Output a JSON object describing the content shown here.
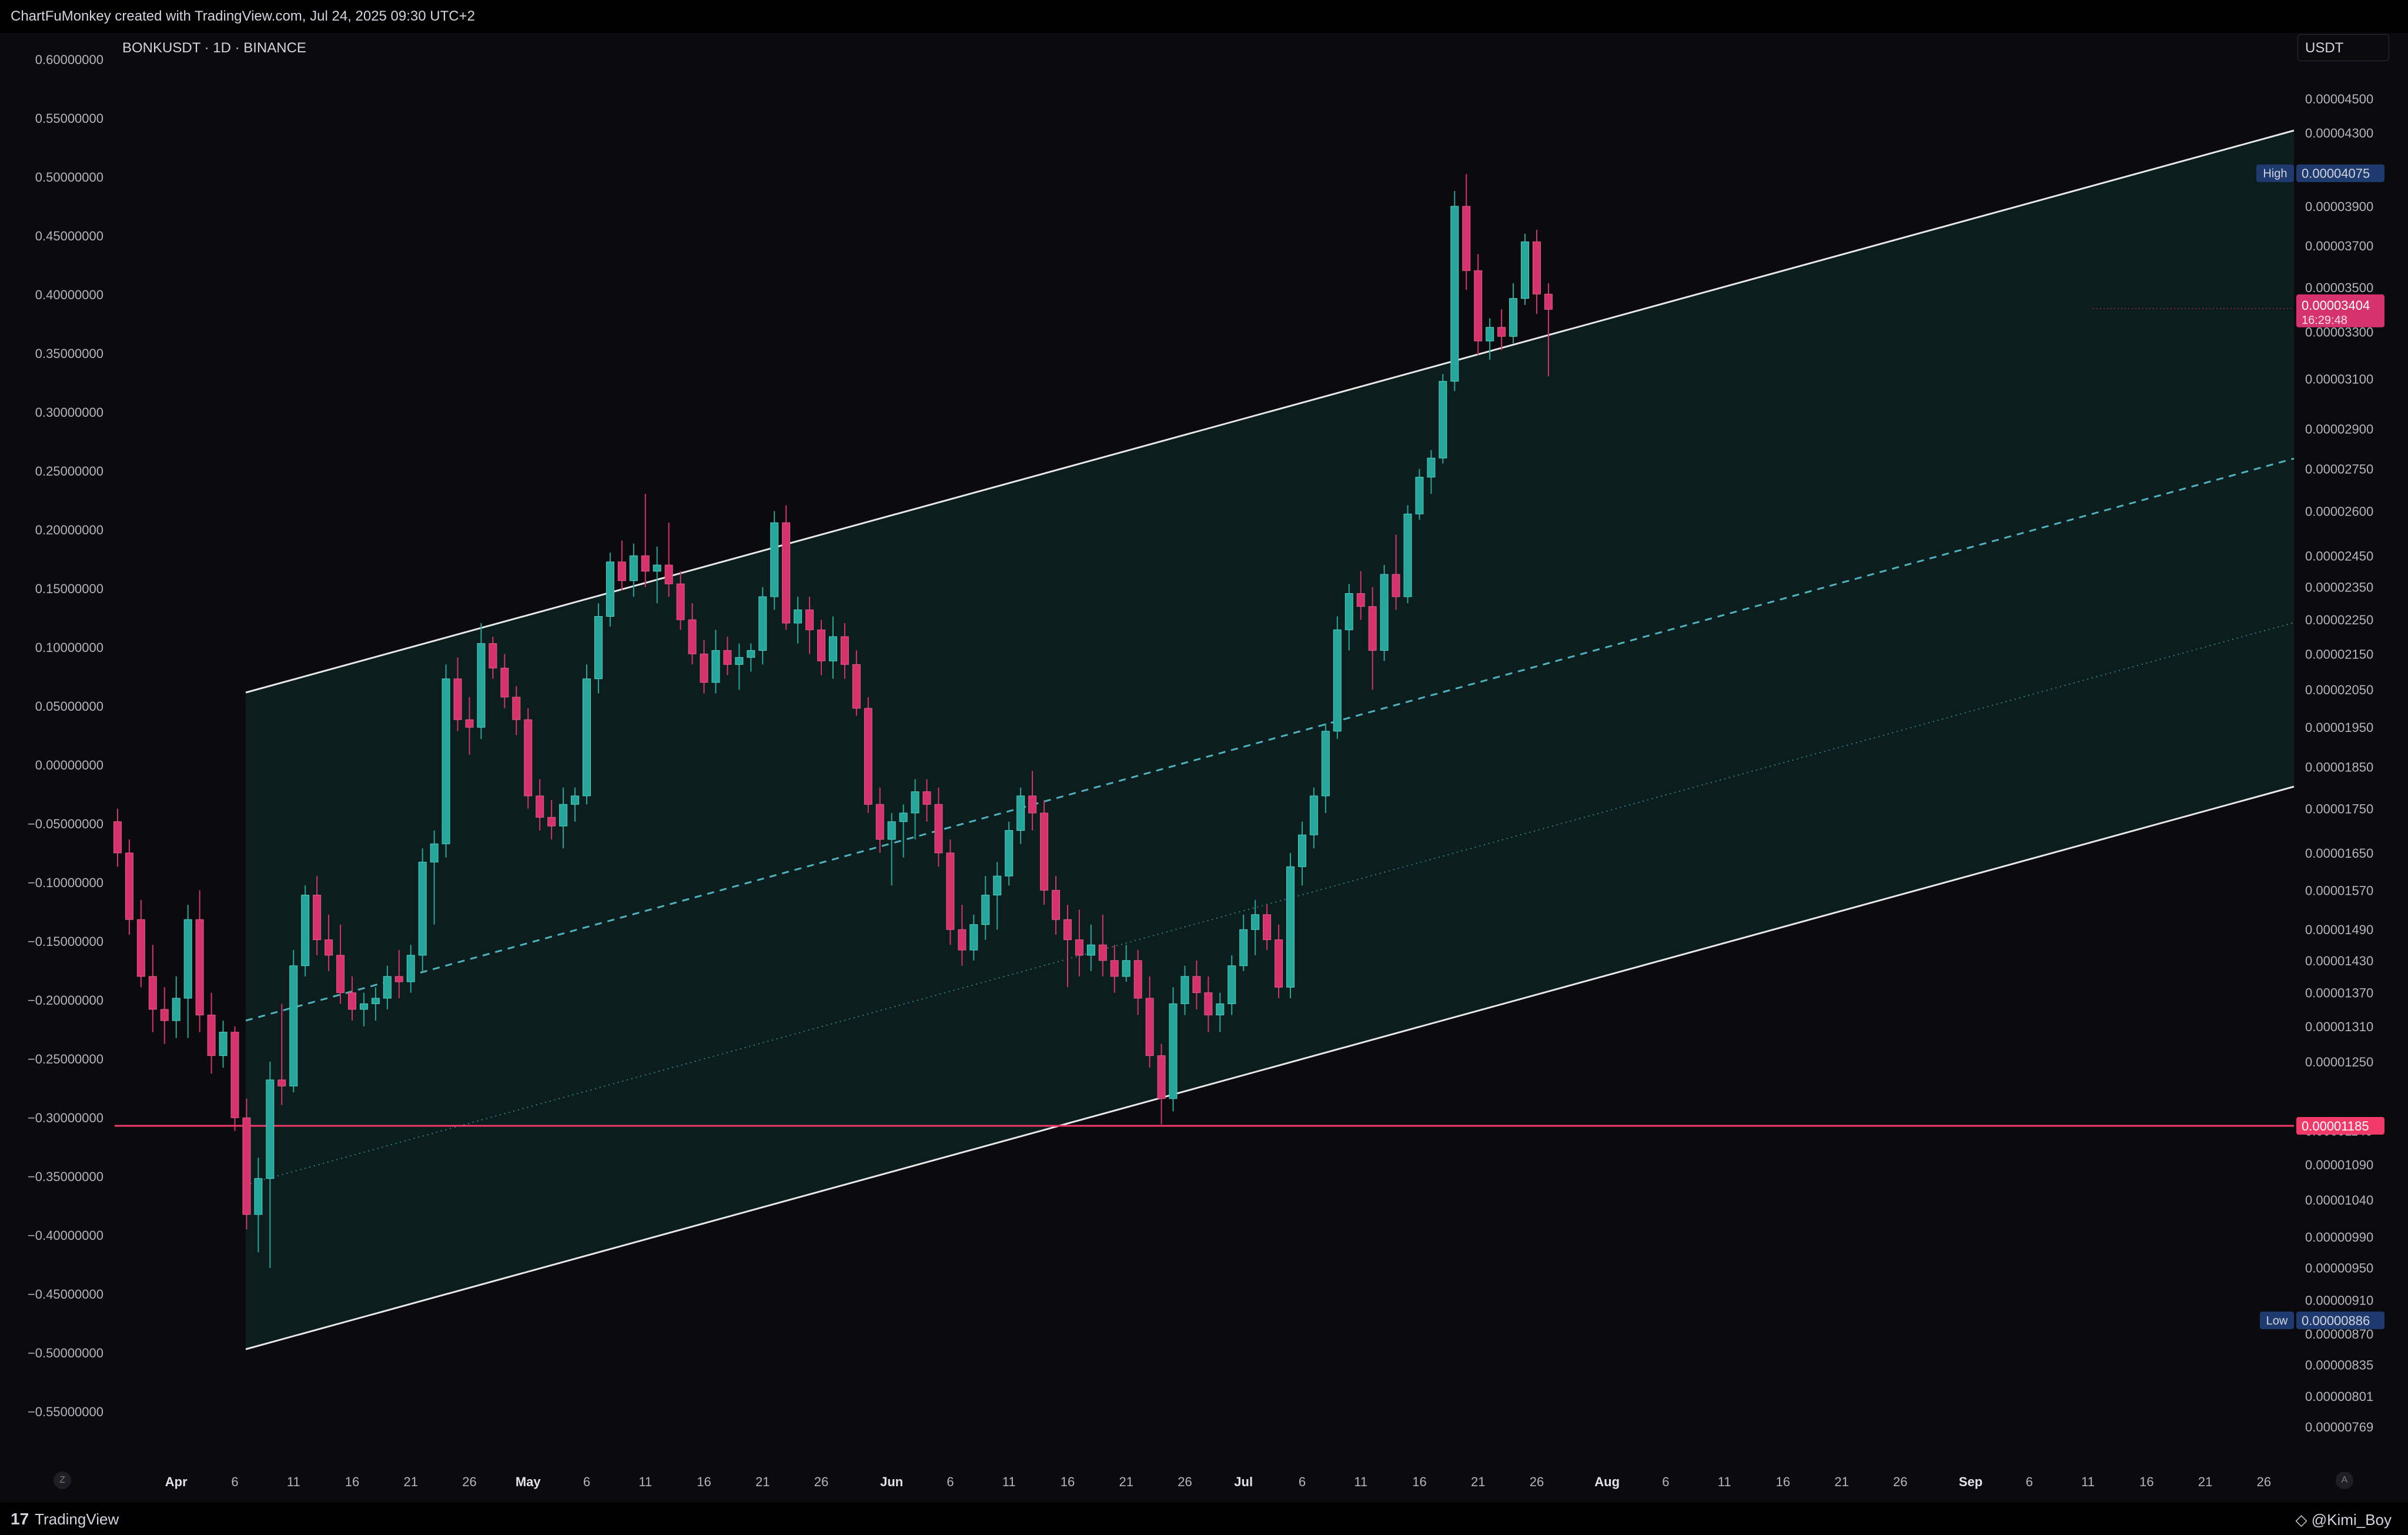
{
  "header": {
    "credit_line": "ChartFuMonkey created with TradingView.com, Jul 24, 2025 09:30 UTC+2"
  },
  "chart": {
    "symbol": "BONKUSDT · 1D · BINANCE",
    "currency": "USDT",
    "left_axis_ticks": [
      "0.60000000",
      "0.55000000",
      "0.50000000",
      "0.45000000",
      "0.40000000",
      "0.35000000",
      "0.30000000",
      "0.25000000",
      "0.20000000",
      "0.15000000",
      "0.10000000",
      "0.05000000",
      "0.00000000",
      "−0.05000000",
      "−0.10000000",
      "−0.15000000",
      "−0.20000000",
      "−0.25000000",
      "−0.30000000",
      "−0.35000000",
      "−0.40000000",
      "−0.45000000",
      "−0.50000000",
      "−0.55000000"
    ],
    "right_axis_ticks": [
      "0.00004500",
      "0.00004300",
      "0.00003900",
      "0.00003700",
      "0.00003500",
      "0.00003300",
      "0.00003100",
      "0.00002900",
      "0.00002750",
      "0.00002600",
      "0.00002450",
      "0.00002350",
      "0.00002250",
      "0.00002150",
      "0.00002050",
      "0.00001950",
      "0.00001850",
      "0.00001750",
      "0.00001650",
      "0.00001570",
      "0.00001490",
      "0.00001430",
      "0.00001370",
      "0.00001310",
      "0.00001250",
      "0.00001140",
      "0.00001090",
      "0.00001040",
      "0.00000990",
      "0.00000950",
      "0.00000910",
      "0.00000870",
      "0.00000835",
      "0.00000801",
      "0.00000769"
    ],
    "x_ticks": [
      "Apr",
      "6",
      "11",
      "16",
      "21",
      "26",
      "May",
      "6",
      "11",
      "16",
      "21",
      "26",
      "Jun",
      "6",
      "11",
      "16",
      "21",
      "26",
      "Jul",
      "6",
      "11",
      "16",
      "21",
      "26",
      "Aug",
      "6",
      "11",
      "16",
      "21",
      "26",
      "Sep",
      "6",
      "11",
      "16",
      "21",
      "26"
    ],
    "high_label": "High",
    "high_value": "0.00004075",
    "low_label": "Low",
    "low_value": "0.00000886",
    "last_price": "0.00003404",
    "countdown": "16:29:48",
    "support_price": "0.00001185",
    "colors": {
      "up": "#26a69a",
      "down": "#d6336c",
      "channel_fill": "#0e2e2e",
      "channel_line": "#e8e8e8",
      "midline": "#4fb3bf",
      "support": "#f23a6a",
      "high_low_badge": "#1e3a6e"
    }
  },
  "footer": {
    "brand": "TradingView",
    "watermark": "@Kimi_Boy"
  },
  "chart_data": {
    "type": "candlestick",
    "symbol": "BONKUSDT",
    "interval": "1D",
    "exchange": "BINANCE",
    "x_range": [
      "Mar 26 2025",
      "Sep 30 2025"
    ],
    "y_scale": "log",
    "y_range": [
      7.69e-06,
      4.6e-05
    ],
    "ohlc": [
      [
        "Mar 27",
        1.72e-05,
        1.75e-05,
        1.62e-05,
        1.65e-05
      ],
      [
        "Mar 28",
        1.65e-05,
        1.68e-05,
        1.48e-05,
        1.51e-05
      ],
      [
        "Mar 29",
        1.51e-05,
        1.55e-05,
        1.38e-05,
        1.4e-05
      ],
      [
        "Mar 30",
        1.4e-05,
        1.46e-05,
        1.3e-05,
        1.34e-05
      ],
      [
        "Mar 31",
        1.34e-05,
        1.38e-05,
        1.28e-05,
        1.32e-05
      ],
      [
        "Apr 1",
        1.32e-05,
        1.4e-05,
        1.29e-05,
        1.36e-05
      ],
      [
        "Apr 2",
        1.36e-05,
        1.54e-05,
        1.29e-05,
        1.51e-05
      ],
      [
        "Apr 3",
        1.51e-05,
        1.57e-05,
        1.3e-05,
        1.33e-05
      ],
      [
        "Apr 4",
        1.33e-05,
        1.37e-05,
        1.23e-05,
        1.26e-05
      ],
      [
        "Apr 5",
        1.26e-05,
        1.32e-05,
        1.24e-05,
        1.3e-05
      ],
      [
        "Apr 6",
        1.3e-05,
        1.31e-05,
        1.14e-05,
        1.16e-05
      ],
      [
        "Apr 7",
        1.16e-05,
        1.19e-05,
        1e-05,
        1.02e-05
      ],
      [
        "Apr 8",
        1.02e-05,
        1.1e-05,
        9.7e-06,
        1.07e-05
      ],
      [
        "Apr 9",
        1.07e-05,
        1.25e-05,
        9.5e-06,
        1.22e-05
      ],
      [
        "Apr 10",
        1.22e-05,
        1.35e-05,
        1.18e-05,
        1.21e-05
      ],
      [
        "Apr 11",
        1.21e-05,
        1.45e-05,
        1.2e-05,
        1.42e-05
      ],
      [
        "Apr 12",
        1.42e-05,
        1.58e-05,
        1.4e-05,
        1.56e-05
      ],
      [
        "Apr 13",
        1.56e-05,
        1.6e-05,
        1.44e-05,
        1.47e-05
      ],
      [
        "Apr 14",
        1.47e-05,
        1.52e-05,
        1.41e-05,
        1.44e-05
      ],
      [
        "Apr 15",
        1.44e-05,
        1.5e-05,
        1.35e-05,
        1.37e-05
      ],
      [
        "Apr 16",
        1.37e-05,
        1.4e-05,
        1.32e-05,
        1.34e-05
      ],
      [
        "Apr 17",
        1.34e-05,
        1.37e-05,
        1.31e-05,
        1.35e-05
      ],
      [
        "Apr 18",
        1.35e-05,
        1.38e-05,
        1.32e-05,
        1.36e-05
      ],
      [
        "Apr 19",
        1.36e-05,
        1.42e-05,
        1.34e-05,
        1.4e-05
      ],
      [
        "Apr 20",
        1.4e-05,
        1.45e-05,
        1.36e-05,
        1.39e-05
      ],
      [
        "Apr 21",
        1.39e-05,
        1.46e-05,
        1.37e-05,
        1.44e-05
      ],
      [
        "Apr 22",
        1.44e-05,
        1.66e-05,
        1.41e-05,
        1.63e-05
      ],
      [
        "Apr 23",
        1.63e-05,
        1.7e-05,
        1.5e-05,
        1.67e-05
      ],
      [
        "Apr 24",
        1.67e-05,
        2.12e-05,
        1.64e-05,
        2.08e-05
      ],
      [
        "Apr 25",
        2.08e-05,
        2.14e-05,
        1.94e-05,
        1.97e-05
      ],
      [
        "Apr 26",
        1.97e-05,
        2.03e-05,
        1.88e-05,
        1.95e-05
      ],
      [
        "Apr 27",
        1.95e-05,
        2.24e-05,
        1.92e-05,
        2.18e-05
      ],
      [
        "Apr 28",
        2.18e-05,
        2.2e-05,
        2.08e-05,
        2.11e-05
      ],
      [
        "Apr 29",
        2.11e-05,
        2.15e-05,
        2e-05,
        2.03e-05
      ],
      [
        "Apr 30",
        2.03e-05,
        2.06e-05,
        1.93e-05,
        1.97e-05
      ],
      [
        "May 1",
        1.97e-05,
        2e-05,
        1.75e-05,
        1.78e-05
      ],
      [
        "May 2",
        1.78e-05,
        1.82e-05,
        1.7e-05,
        1.73e-05
      ],
      [
        "May 3",
        1.73e-05,
        1.77e-05,
        1.68e-05,
        1.71e-05
      ],
      [
        "May 4",
        1.71e-05,
        1.8e-05,
        1.66e-05,
        1.76e-05
      ],
      [
        "May 5",
        1.76e-05,
        1.8e-05,
        1.72e-05,
        1.78e-05
      ],
      [
        "May 6",
        1.78e-05,
        2.12e-05,
        1.76e-05,
        2.08e-05
      ],
      [
        "May 7",
        2.08e-05,
        2.3e-05,
        2.04e-05,
        2.26e-05
      ],
      [
        "May 8",
        2.26e-05,
        2.46e-05,
        2.23e-05,
        2.43e-05
      ],
      [
        "May 9",
        2.43e-05,
        2.5e-05,
        2.34e-05,
        2.37e-05
      ],
      [
        "May 10",
        2.37e-05,
        2.49e-05,
        2.32e-05,
        2.45e-05
      ],
      [
        "May 11",
        2.45e-05,
        2.66e-05,
        2.35e-05,
        2.4e-05
      ],
      [
        "May 12",
        2.4e-05,
        2.48e-05,
        2.3e-05,
        2.42e-05
      ],
      [
        "May 13",
        2.42e-05,
        2.56e-05,
        2.32e-05,
        2.36e-05
      ],
      [
        "May 14",
        2.36e-05,
        2.4e-05,
        2.22e-05,
        2.25e-05
      ],
      [
        "May 15",
        2.25e-05,
        2.3e-05,
        2.12e-05,
        2.15e-05
      ],
      [
        "May 16",
        2.15e-05,
        2.19e-05,
        2.04e-05,
        2.07e-05
      ],
      [
        "May 17",
        2.07e-05,
        2.22e-05,
        2.04e-05,
        2.16e-05
      ],
      [
        "May 18",
        2.16e-05,
        2.2e-05,
        2.09e-05,
        2.12e-05
      ],
      [
        "May 19",
        2.12e-05,
        2.18e-05,
        2.05e-05,
        2.14e-05
      ],
      [
        "May 20",
        2.14e-05,
        2.18e-05,
        2.1e-05,
        2.16e-05
      ],
      [
        "May 21",
        2.16e-05,
        2.35e-05,
        2.12e-05,
        2.32e-05
      ],
      [
        "May 22",
        2.32e-05,
        2.6e-05,
        2.28e-05,
        2.56e-05
      ],
      [
        "May 23",
        2.56e-05,
        2.62e-05,
        2.22e-05,
        2.24e-05
      ],
      [
        "May 24",
        2.24e-05,
        2.32e-05,
        2.18e-05,
        2.28e-05
      ],
      [
        "May 25",
        2.28e-05,
        2.32e-05,
        2.15e-05,
        2.22e-05
      ],
      [
        "May 26",
        2.22e-05,
        2.25e-05,
        2.09e-05,
        2.13e-05
      ],
      [
        "May 27",
        2.13e-05,
        2.26e-05,
        2.08e-05,
        2.2e-05
      ],
      [
        "May 28",
        2.2e-05,
        2.24e-05,
        2.08e-05,
        2.12e-05
      ],
      [
        "May 29",
        2.12e-05,
        2.16e-05,
        1.98e-05,
        2e-05
      ],
      [
        "May 30",
        2e-05,
        2.03e-05,
        1.74e-05,
        1.76e-05
      ],
      [
        "May 31",
        1.76e-05,
        1.8e-05,
        1.65e-05,
        1.68e-05
      ],
      [
        "Jun 1",
        1.68e-05,
        1.74e-05,
        1.58e-05,
        1.72e-05
      ],
      [
        "Jun 2",
        1.72e-05,
        1.76e-05,
        1.64e-05,
        1.74e-05
      ],
      [
        "Jun 3",
        1.74e-05,
        1.82e-05,
        1.68e-05,
        1.79e-05
      ],
      [
        "Jun 4",
        1.79e-05,
        1.82e-05,
        1.72e-05,
        1.76e-05
      ],
      [
        "Jun 5",
        1.76e-05,
        1.8e-05,
        1.62e-05,
        1.65e-05
      ],
      [
        "Jun 6",
        1.65e-05,
        1.68e-05,
        1.46e-05,
        1.49e-05
      ],
      [
        "Jun 7",
        1.49e-05,
        1.54e-05,
        1.42e-05,
        1.45e-05
      ],
      [
        "Jun 8",
        1.45e-05,
        1.52e-05,
        1.43e-05,
        1.5e-05
      ],
      [
        "Jun 9",
        1.5e-05,
        1.6e-05,
        1.47e-05,
        1.56e-05
      ],
      [
        "Jun 10",
        1.56e-05,
        1.63e-05,
        1.49e-05,
        1.6e-05
      ],
      [
        "Jun 11",
        1.6e-05,
        1.72e-05,
        1.58e-05,
        1.7e-05
      ],
      [
        "Jun 12",
        1.7e-05,
        1.8e-05,
        1.67e-05,
        1.78e-05
      ],
      [
        "Jun 13",
        1.78e-05,
        1.84e-05,
        1.7e-05,
        1.74e-05
      ],
      [
        "Jun 14",
        1.74e-05,
        1.77e-05,
        1.54e-05,
        1.57e-05
      ],
      [
        "Jun 15",
        1.57e-05,
        1.6e-05,
        1.48e-05,
        1.51e-05
      ],
      [
        "Jun 16",
        1.51e-05,
        1.54e-05,
        1.38e-05,
        1.47e-05
      ],
      [
        "Jun 17",
        1.47e-05,
        1.53e-05,
        1.4e-05,
        1.44e-05
      ],
      [
        "Jun 18",
        1.44e-05,
        1.5e-05,
        1.41e-05,
        1.46e-05
      ],
      [
        "Jun 19",
        1.46e-05,
        1.52e-05,
        1.4e-05,
        1.43e-05
      ],
      [
        "Jun 20",
        1.43e-05,
        1.46e-05,
        1.37e-05,
        1.4e-05
      ],
      [
        "Jun 21",
        1.4e-05,
        1.46e-05,
        1.39e-05,
        1.43e-05
      ],
      [
        "Jun 22",
        1.43e-05,
        1.45e-05,
        1.33e-05,
        1.36e-05
      ],
      [
        "Jun 23",
        1.36e-05,
        1.4e-05,
        1.24e-05,
        1.26e-05
      ],
      [
        "Jun 24",
        1.26e-05,
        1.28e-05,
        1.15e-05,
        1.19e-05
      ],
      [
        "Jun 25",
        1.19e-05,
        1.38e-05,
        1.17e-05,
        1.35e-05
      ],
      [
        "Jun 26",
        1.35e-05,
        1.42e-05,
        1.33e-05,
        1.4e-05
      ],
      [
        "Jun 27",
        1.4e-05,
        1.43e-05,
        1.34e-05,
        1.37e-05
      ],
      [
        "Jun 28",
        1.37e-05,
        1.4e-05,
        1.3e-05,
        1.33e-05
      ],
      [
        "Jun 29",
        1.33e-05,
        1.37e-05,
        1.3e-05,
        1.35e-05
      ],
      [
        "Jun 30",
        1.35e-05,
        1.44e-05,
        1.33e-05,
        1.42e-05
      ],
      [
        "Jul 1",
        1.42e-05,
        1.52e-05,
        1.41e-05,
        1.49e-05
      ],
      [
        "Jul 2",
        1.49e-05,
        1.55e-05,
        1.44e-05,
        1.52e-05
      ],
      [
        "Jul 3",
        1.52e-05,
        1.54e-05,
        1.45e-05,
        1.47e-05
      ],
      [
        "Jul 4",
        1.47e-05,
        1.5e-05,
        1.36e-05,
        1.38e-05
      ],
      [
        "Jul 5",
        1.38e-05,
        1.65e-05,
        1.36e-05,
        1.62e-05
      ],
      [
        "Jul 6",
        1.62e-05,
        1.72e-05,
        1.58e-05,
        1.69e-05
      ],
      [
        "Jul 7",
        1.69e-05,
        1.8e-05,
        1.66e-05,
        1.78e-05
      ],
      [
        "Jul 8",
        1.78e-05,
        1.96e-05,
        1.74e-05,
        1.94e-05
      ],
      [
        "Jul 9",
        1.94e-05,
        2.26e-05,
        1.92e-05,
        2.22e-05
      ],
      [
        "Jul 10",
        2.22e-05,
        2.36e-05,
        2.16e-05,
        2.33e-05
      ],
      [
        "Jul 11",
        2.33e-05,
        2.4e-05,
        2.25e-05,
        2.29e-05
      ],
      [
        "Jul 12",
        2.29e-05,
        2.35e-05,
        2.05e-05,
        2.16e-05
      ],
      [
        "Jul 13",
        2.16e-05,
        2.42e-05,
        2.13e-05,
        2.39e-05
      ],
      [
        "Jul 14",
        2.39e-05,
        2.52e-05,
        2.28e-05,
        2.32e-05
      ],
      [
        "Jul 15",
        2.32e-05,
        2.62e-05,
        2.3e-05,
        2.59e-05
      ],
      [
        "Jul 16",
        2.59e-05,
        2.75e-05,
        2.57e-05,
        2.72e-05
      ],
      [
        "Jul 17",
        2.72e-05,
        2.82e-05,
        2.66e-05,
        2.79e-05
      ],
      [
        "Jul 18",
        2.79e-05,
        3.12e-05,
        2.77e-05,
        3.09e-05
      ],
      [
        "Jul 19",
        3.09e-05,
        3.98e-05,
        3.05e-05,
        3.9e-05
      ],
      [
        "Jul 20",
        3.9e-05,
        4.07e-05,
        3.49e-05,
        3.58e-05
      ],
      [
        "Jul 21",
        3.58e-05,
        3.66e-05,
        3.2e-05,
        3.26e-05
      ],
      [
        "Jul 22",
        3.26e-05,
        3.36e-05,
        3.18e-05,
        3.32e-05
      ],
      [
        "Jul 23",
        3.32e-05,
        3.4e-05,
        3.22e-05,
        3.28e-05
      ],
      [
        "Jul 24",
        3.28e-05,
        3.52e-05,
        3.25e-05,
        3.45e-05
      ],
      [
        "Jul 25",
        3.45e-05,
        3.76e-05,
        3.42e-05,
        3.72e-05
      ],
      [
        "Jul 26",
        3.72e-05,
        3.78e-05,
        3.38e-05,
        3.47e-05
      ],
      [
        "Jul 27",
        3.47e-05,
        3.52e-05,
        3.11e-05,
        3.4e-05
      ]
    ]
  }
}
